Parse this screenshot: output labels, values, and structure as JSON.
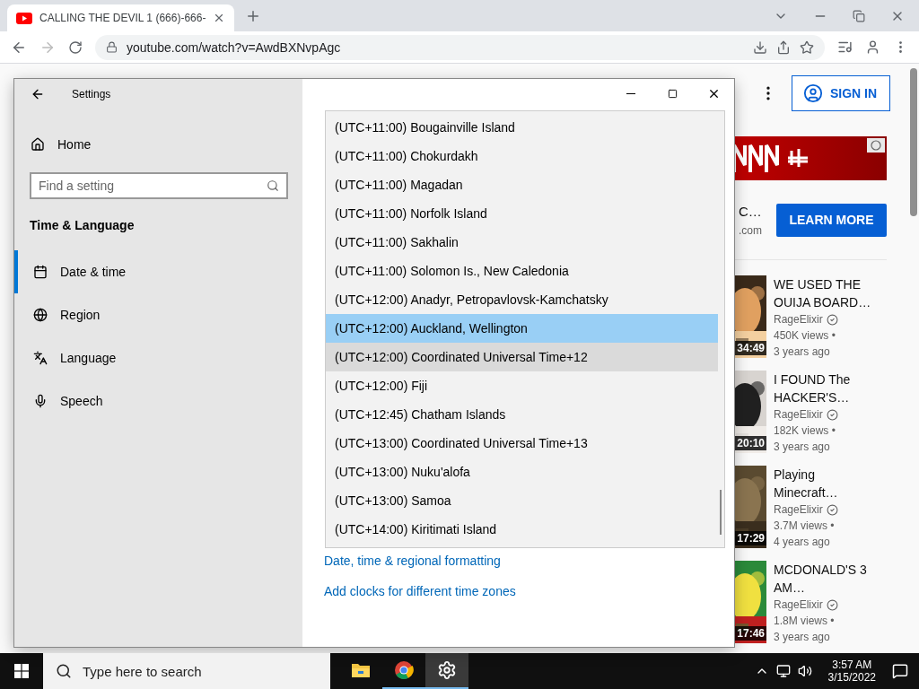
{
  "browser": {
    "tab": {
      "title": "CALLING THE DEVIL 1 (666)-666-",
      "selected": true
    },
    "address": "youtube.com/watch?v=AwdBXNvpAgc"
  },
  "youtube": {
    "sign_in": "SIGN IN",
    "ad": {
      "title": "C…",
      "domain": ".com",
      "button": "LEARN MORE"
    },
    "videos": [
      {
        "title": "WE USED THE OUIJA BOARD…",
        "channel": "RageElixir",
        "views": "450K views •",
        "age": "3 years ago",
        "duration": "34:49"
      },
      {
        "title": "I FOUND The HACKER'S…",
        "channel": "RageElixir",
        "views": "182K views •",
        "age": "3 years ago",
        "duration": "20:10"
      },
      {
        "title": "Playing Minecraft…",
        "channel": "RageElixir",
        "views": "3.7M views •",
        "age": "4 years ago",
        "duration": "17:29"
      },
      {
        "title": "MCDONALD'S 3 AM…",
        "channel": "RageElixir",
        "views": "1.8M views •",
        "age": "3 years ago",
        "duration": "17:46"
      }
    ]
  },
  "settings": {
    "title": "Settings",
    "home": "Home",
    "search_placeholder": "Find a setting",
    "section": "Time & Language",
    "nav": [
      {
        "label": "Date & time",
        "selected": true,
        "kind": "calendar"
      },
      {
        "label": "Region",
        "selected": false,
        "kind": "globe"
      },
      {
        "label": "Language",
        "selected": false,
        "kind": "language"
      },
      {
        "label": "Speech",
        "selected": false,
        "kind": "mic"
      }
    ],
    "timezones": [
      {
        "label": "(UTC+11:00) Bougainville Island",
        "selected": false,
        "hovered": false
      },
      {
        "label": "(UTC+11:00) Chokurdakh",
        "selected": false,
        "hovered": false
      },
      {
        "label": "(UTC+11:00) Magadan",
        "selected": false,
        "hovered": false
      },
      {
        "label": "(UTC+11:00) Norfolk Island",
        "selected": false,
        "hovered": false
      },
      {
        "label": "(UTC+11:00) Sakhalin",
        "selected": false,
        "hovered": false
      },
      {
        "label": "(UTC+11:00) Solomon Is., New Caledonia",
        "selected": false,
        "hovered": false
      },
      {
        "label": "(UTC+12:00) Anadyr, Petropavlovsk-Kamchatsky",
        "selected": false,
        "hovered": false
      },
      {
        "label": "(UTC+12:00) Auckland, Wellington",
        "selected": true,
        "hovered": false
      },
      {
        "label": "(UTC+12:00) Coordinated Universal Time+12",
        "selected": false,
        "hovered": true
      },
      {
        "label": "(UTC+12:00) Fiji",
        "selected": false,
        "hovered": false
      },
      {
        "label": "(UTC+12:45) Chatham Islands",
        "selected": false,
        "hovered": false
      },
      {
        "label": "(UTC+13:00) Coordinated Universal Time+13",
        "selected": false,
        "hovered": false
      },
      {
        "label": "(UTC+13:00) Nuku'alofa",
        "selected": false,
        "hovered": false
      },
      {
        "label": "(UTC+13:00) Samoa",
        "selected": false,
        "hovered": false
      },
      {
        "label": "(UTC+14:00) Kiritimati Island",
        "selected": false,
        "hovered": false
      }
    ],
    "links": [
      "Date, time & regional formatting",
      "Add clocks for different time zones"
    ]
  },
  "taskbar": {
    "search_placeholder": "Type here to search",
    "apps": [
      {
        "kind": "explorer",
        "running": false,
        "active": false
      },
      {
        "kind": "chrome",
        "running": true,
        "active": false
      },
      {
        "kind": "settings",
        "running": true,
        "active": true
      }
    ],
    "time": "3:57 AM",
    "date": "3/15/2022"
  }
}
